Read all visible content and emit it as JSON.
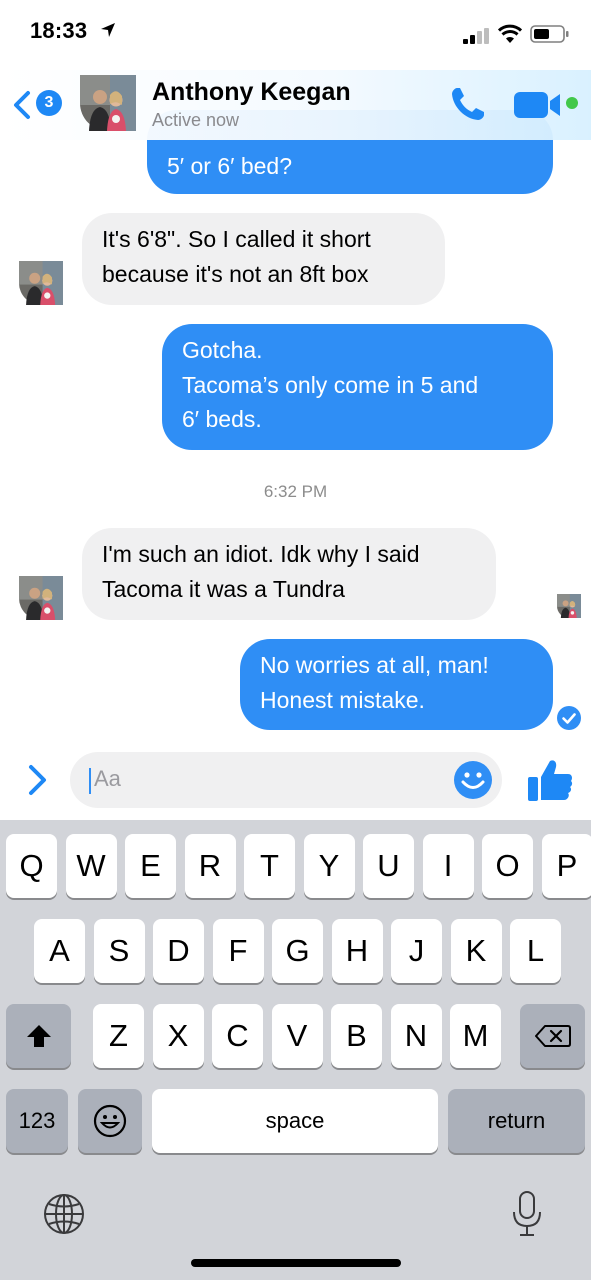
{
  "status_bar": {
    "time": "18:33"
  },
  "header": {
    "unread_count": "3",
    "contact_name": "Anthony Keegan",
    "presence": "Active now"
  },
  "conversation": {
    "messages": [
      {
        "sender": "me",
        "text": "5′ or 6′ bed?"
      },
      {
        "sender": "contact",
        "text": "It's 6'8\". So I called it short\nbecause it's not an 8ft box"
      },
      {
        "sender": "me",
        "text": "Gotcha.\nTacoma’s only come in 5 and\n6′ beds."
      },
      {
        "sender": "contact",
        "text": "I'm such an idiot. Idk why I said\nTacoma it was a Tundra"
      },
      {
        "sender": "me",
        "text": "No worries at all, man!\nHonest mistake."
      }
    ],
    "timestamp": "6:32 PM"
  },
  "composer": {
    "placeholder": "Aa"
  },
  "keyboard": {
    "row1": [
      "Q",
      "W",
      "E",
      "R",
      "T",
      "Y",
      "U",
      "I",
      "O",
      "P"
    ],
    "row2": [
      "A",
      "S",
      "D",
      "F",
      "G",
      "H",
      "J",
      "K",
      "L"
    ],
    "row3": [
      "Z",
      "X",
      "C",
      "V",
      "B",
      "N",
      "M"
    ],
    "numbers_label": "123",
    "space_label": "space",
    "return_label": "return"
  },
  "colors": {
    "accent": "#2f8ef5",
    "online": "#42c84a",
    "incoming_bubble": "#f0f0f1",
    "keyboard_bg": "#d2d4d9"
  },
  "icons": [
    "location-arrow-icon",
    "signal-icon",
    "wifi-icon",
    "battery-icon",
    "back-chevron-icon",
    "phone-icon",
    "video-camera-icon",
    "chevron-right-icon",
    "smiley-icon",
    "thumbs-up-icon",
    "shift-icon",
    "backspace-icon",
    "emoji-keyboard-icon",
    "globe-icon",
    "microphone-icon",
    "delivered-check-icon"
  ]
}
